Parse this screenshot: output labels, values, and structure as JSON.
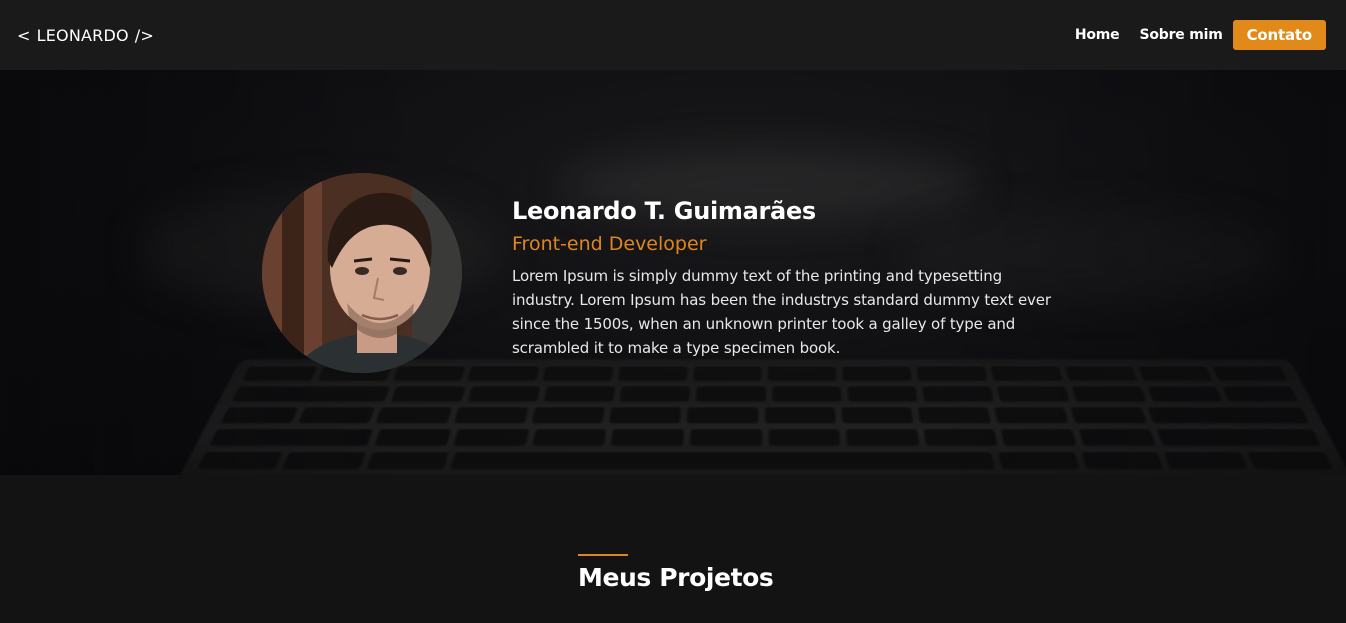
{
  "header": {
    "logo_open": "<",
    "logo_text": "LEONARDO",
    "logo_close": "/>",
    "nav": {
      "home": "Home",
      "about": "Sobre mim",
      "contact": "Contato"
    }
  },
  "hero": {
    "name": "Leonardo T. Guimarães",
    "role": "Front-end Developer",
    "bio": "Lorem Ipsum is simply dummy text of the printing and typesetting industry. Lorem Ipsum has been the industrys standard dummy text ever since the 1500s, when an unknown printer took a galley of type and scrambled it to make a type specimen book."
  },
  "projects": {
    "title": "Meus Projetos"
  },
  "colors": {
    "accent": "#e1861e",
    "header_bg": "#1a1a1a",
    "page_bg": "#131313"
  }
}
